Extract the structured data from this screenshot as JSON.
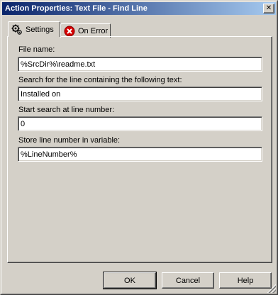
{
  "window": {
    "title": "Action Properties: Text File - Find Line",
    "close_glyph": "✕"
  },
  "tabs": [
    {
      "label": "Settings",
      "icon": "gear-icon",
      "active": true
    },
    {
      "label": "On Error",
      "icon": "error-icon",
      "active": false,
      "icon_color": "#d40000"
    }
  ],
  "fields": {
    "file_name": {
      "label": "File name:",
      "value": "%SrcDir%\\readme.txt"
    },
    "search_text": {
      "label": "Search for the line containing the following text:",
      "value": "Installed on"
    },
    "start_line": {
      "label": "Start search at line number:",
      "value": "0"
    },
    "store_var": {
      "label": "Store line number in variable:",
      "value": "%LineNumber%"
    }
  },
  "buttons": {
    "ok": "OK",
    "cancel": "Cancel",
    "help": "Help"
  },
  "colors": {
    "titlebar_start": "#0a246a",
    "titlebar_end": "#a6caf0",
    "face": "#d4d0c8"
  }
}
